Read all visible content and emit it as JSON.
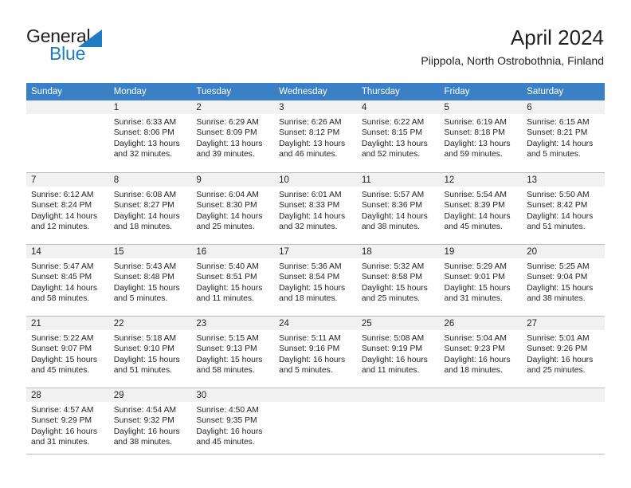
{
  "brand": {
    "name_part1": "General",
    "name_part2": "Blue",
    "triangle_icon": "triangle-icon",
    "colors": {
      "blue": "#1e7bc4",
      "dark": "#231f20"
    }
  },
  "header": {
    "title": "April 2024",
    "subtitle": "Piippola, North Ostrobothnia, Finland"
  },
  "calendar": {
    "header_bg": "#3b7fc4",
    "daynum_bg": "#f1f1f1",
    "weekdays": [
      "Sunday",
      "Monday",
      "Tuesday",
      "Wednesday",
      "Thursday",
      "Friday",
      "Saturday"
    ],
    "weeks": [
      [
        {
          "day": "",
          "sunrise": "",
          "sunset": "",
          "daylight1": "",
          "daylight2": ""
        },
        {
          "day": "1",
          "sunrise": "Sunrise: 6:33 AM",
          "sunset": "Sunset: 8:06 PM",
          "daylight1": "Daylight: 13 hours",
          "daylight2": "and 32 minutes."
        },
        {
          "day": "2",
          "sunrise": "Sunrise: 6:29 AM",
          "sunset": "Sunset: 8:09 PM",
          "daylight1": "Daylight: 13 hours",
          "daylight2": "and 39 minutes."
        },
        {
          "day": "3",
          "sunrise": "Sunrise: 6:26 AM",
          "sunset": "Sunset: 8:12 PM",
          "daylight1": "Daylight: 13 hours",
          "daylight2": "and 46 minutes."
        },
        {
          "day": "4",
          "sunrise": "Sunrise: 6:22 AM",
          "sunset": "Sunset: 8:15 PM",
          "daylight1": "Daylight: 13 hours",
          "daylight2": "and 52 minutes."
        },
        {
          "day": "5",
          "sunrise": "Sunrise: 6:19 AM",
          "sunset": "Sunset: 8:18 PM",
          "daylight1": "Daylight: 13 hours",
          "daylight2": "and 59 minutes."
        },
        {
          "day": "6",
          "sunrise": "Sunrise: 6:15 AM",
          "sunset": "Sunset: 8:21 PM",
          "daylight1": "Daylight: 14 hours",
          "daylight2": "and 5 minutes."
        }
      ],
      [
        {
          "day": "7",
          "sunrise": "Sunrise: 6:12 AM",
          "sunset": "Sunset: 8:24 PM",
          "daylight1": "Daylight: 14 hours",
          "daylight2": "and 12 minutes."
        },
        {
          "day": "8",
          "sunrise": "Sunrise: 6:08 AM",
          "sunset": "Sunset: 8:27 PM",
          "daylight1": "Daylight: 14 hours",
          "daylight2": "and 18 minutes."
        },
        {
          "day": "9",
          "sunrise": "Sunrise: 6:04 AM",
          "sunset": "Sunset: 8:30 PM",
          "daylight1": "Daylight: 14 hours",
          "daylight2": "and 25 minutes."
        },
        {
          "day": "10",
          "sunrise": "Sunrise: 6:01 AM",
          "sunset": "Sunset: 8:33 PM",
          "daylight1": "Daylight: 14 hours",
          "daylight2": "and 32 minutes."
        },
        {
          "day": "11",
          "sunrise": "Sunrise: 5:57 AM",
          "sunset": "Sunset: 8:36 PM",
          "daylight1": "Daylight: 14 hours",
          "daylight2": "and 38 minutes."
        },
        {
          "day": "12",
          "sunrise": "Sunrise: 5:54 AM",
          "sunset": "Sunset: 8:39 PM",
          "daylight1": "Daylight: 14 hours",
          "daylight2": "and 45 minutes."
        },
        {
          "day": "13",
          "sunrise": "Sunrise: 5:50 AM",
          "sunset": "Sunset: 8:42 PM",
          "daylight1": "Daylight: 14 hours",
          "daylight2": "and 51 minutes."
        }
      ],
      [
        {
          "day": "14",
          "sunrise": "Sunrise: 5:47 AM",
          "sunset": "Sunset: 8:45 PM",
          "daylight1": "Daylight: 14 hours",
          "daylight2": "and 58 minutes."
        },
        {
          "day": "15",
          "sunrise": "Sunrise: 5:43 AM",
          "sunset": "Sunset: 8:48 PM",
          "daylight1": "Daylight: 15 hours",
          "daylight2": "and 5 minutes."
        },
        {
          "day": "16",
          "sunrise": "Sunrise: 5:40 AM",
          "sunset": "Sunset: 8:51 PM",
          "daylight1": "Daylight: 15 hours",
          "daylight2": "and 11 minutes."
        },
        {
          "day": "17",
          "sunrise": "Sunrise: 5:36 AM",
          "sunset": "Sunset: 8:54 PM",
          "daylight1": "Daylight: 15 hours",
          "daylight2": "and 18 minutes."
        },
        {
          "day": "18",
          "sunrise": "Sunrise: 5:32 AM",
          "sunset": "Sunset: 8:58 PM",
          "daylight1": "Daylight: 15 hours",
          "daylight2": "and 25 minutes."
        },
        {
          "day": "19",
          "sunrise": "Sunrise: 5:29 AM",
          "sunset": "Sunset: 9:01 PM",
          "daylight1": "Daylight: 15 hours",
          "daylight2": "and 31 minutes."
        },
        {
          "day": "20",
          "sunrise": "Sunrise: 5:25 AM",
          "sunset": "Sunset: 9:04 PM",
          "daylight1": "Daylight: 15 hours",
          "daylight2": "and 38 minutes."
        }
      ],
      [
        {
          "day": "21",
          "sunrise": "Sunrise: 5:22 AM",
          "sunset": "Sunset: 9:07 PM",
          "daylight1": "Daylight: 15 hours",
          "daylight2": "and 45 minutes."
        },
        {
          "day": "22",
          "sunrise": "Sunrise: 5:18 AM",
          "sunset": "Sunset: 9:10 PM",
          "daylight1": "Daylight: 15 hours",
          "daylight2": "and 51 minutes."
        },
        {
          "day": "23",
          "sunrise": "Sunrise: 5:15 AM",
          "sunset": "Sunset: 9:13 PM",
          "daylight1": "Daylight: 15 hours",
          "daylight2": "and 58 minutes."
        },
        {
          "day": "24",
          "sunrise": "Sunrise: 5:11 AM",
          "sunset": "Sunset: 9:16 PM",
          "daylight1": "Daylight: 16 hours",
          "daylight2": "and 5 minutes."
        },
        {
          "day": "25",
          "sunrise": "Sunrise: 5:08 AM",
          "sunset": "Sunset: 9:19 PM",
          "daylight1": "Daylight: 16 hours",
          "daylight2": "and 11 minutes."
        },
        {
          "day": "26",
          "sunrise": "Sunrise: 5:04 AM",
          "sunset": "Sunset: 9:23 PM",
          "daylight1": "Daylight: 16 hours",
          "daylight2": "and 18 minutes."
        },
        {
          "day": "27",
          "sunrise": "Sunrise: 5:01 AM",
          "sunset": "Sunset: 9:26 PM",
          "daylight1": "Daylight: 16 hours",
          "daylight2": "and 25 minutes."
        }
      ],
      [
        {
          "day": "28",
          "sunrise": "Sunrise: 4:57 AM",
          "sunset": "Sunset: 9:29 PM",
          "daylight1": "Daylight: 16 hours",
          "daylight2": "and 31 minutes."
        },
        {
          "day": "29",
          "sunrise": "Sunrise: 4:54 AM",
          "sunset": "Sunset: 9:32 PM",
          "daylight1": "Daylight: 16 hours",
          "daylight2": "and 38 minutes."
        },
        {
          "day": "30",
          "sunrise": "Sunrise: 4:50 AM",
          "sunset": "Sunset: 9:35 PM",
          "daylight1": "Daylight: 16 hours",
          "daylight2": "and 45 minutes."
        },
        {
          "day": "",
          "sunrise": "",
          "sunset": "",
          "daylight1": "",
          "daylight2": ""
        },
        {
          "day": "",
          "sunrise": "",
          "sunset": "",
          "daylight1": "",
          "daylight2": ""
        },
        {
          "day": "",
          "sunrise": "",
          "sunset": "",
          "daylight1": "",
          "daylight2": ""
        },
        {
          "day": "",
          "sunrise": "",
          "sunset": "",
          "daylight1": "",
          "daylight2": ""
        }
      ]
    ]
  }
}
